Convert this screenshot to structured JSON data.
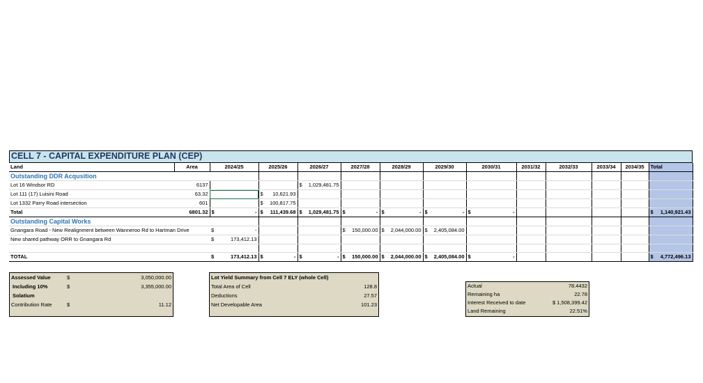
{
  "title": "CELL 7 - CAPITAL EXPENDITURE PLAN (CEP)",
  "header": {
    "land": "Land",
    "area": "Area",
    "years": [
      "2024/25",
      "2025/26",
      "2026/27",
      "2027/28",
      "2028/29",
      "2029/30",
      "2030/31",
      "2031/32",
      "2032/33",
      "2033/34",
      "2034/35"
    ],
    "total": "Total"
  },
  "ddr": {
    "section": "Outstanding DDR Acqusition",
    "rows": [
      {
        "label": "Lot 16 Windsor RD",
        "area": "6137",
        "y2026": "1,029,481.75"
      },
      {
        "label": "Lot 111 (17) Luisini Road",
        "area": "63.32",
        "y2025": "10,621.93"
      },
      {
        "label": "Lot 1332 Parry Road intersection",
        "area": "601",
        "y2025": "100,817.75"
      }
    ],
    "total": {
      "label": "Total",
      "area": "6801.32",
      "y2024": "-",
      "y2025": "111,439.68",
      "y2026": "1,029,481.75",
      "y2027": "-",
      "y2028": "-",
      "y2029": "-",
      "y2030": "-",
      "grand": "1,140,921.43"
    }
  },
  "capital": {
    "section": "Outstanding Capital Works",
    "rows": [
      {
        "label": "Gnangara Road - New Realignment between Wanneroo Rd to Hartman Drive",
        "y2024": "-",
        "y2027": "150,000.00",
        "y2028": "2,044,000.00",
        "y2029": "2,405,084.00"
      },
      {
        "label": "New shared pathway ORR to Gnangara Rd",
        "y2024": "173,412.13"
      }
    ],
    "total": {
      "label": "TOTAL",
      "y2024": "173,412.13",
      "y2025": "-",
      "y2026": "-",
      "y2027": "150,000.00",
      "y2028": "2,044,000.00",
      "y2029": "2,405,084.00",
      "y2030": "-",
      "grand": "4,772,496.13"
    }
  },
  "currency": "$",
  "assessed": {
    "rows": [
      {
        "label": "Assessed Value",
        "cur": "$",
        "val": "3,050,000.00"
      },
      {
        "label": "Including 10%",
        "cur": "$",
        "val": "3,355,000.00"
      },
      {
        "label": "Solatium",
        "cur": "",
        "val": ""
      },
      {
        "label": "Contribution Rate",
        "cur": "$",
        "val": "11.12"
      }
    ]
  },
  "lotyield": {
    "title": "Lot Yield Summary from Cell 7 ELY (whole Cell)",
    "rows": [
      {
        "label": "Total Area of Cell",
        "val": "128.8"
      },
      {
        "label": "Deductions",
        "val": "27.57"
      },
      {
        "label": "Net Developable Area",
        "val": "101.23"
      }
    ]
  },
  "actual": {
    "rows": [
      {
        "label": "Actual",
        "val": "78.4432"
      },
      {
        "label": "Remaining ha",
        "val": "22.78"
      },
      {
        "label": "Interest Received to date",
        "val": "$  1,508,399.42"
      },
      {
        "label": "Land Remaining",
        "val": "22.51%"
      }
    ]
  }
}
